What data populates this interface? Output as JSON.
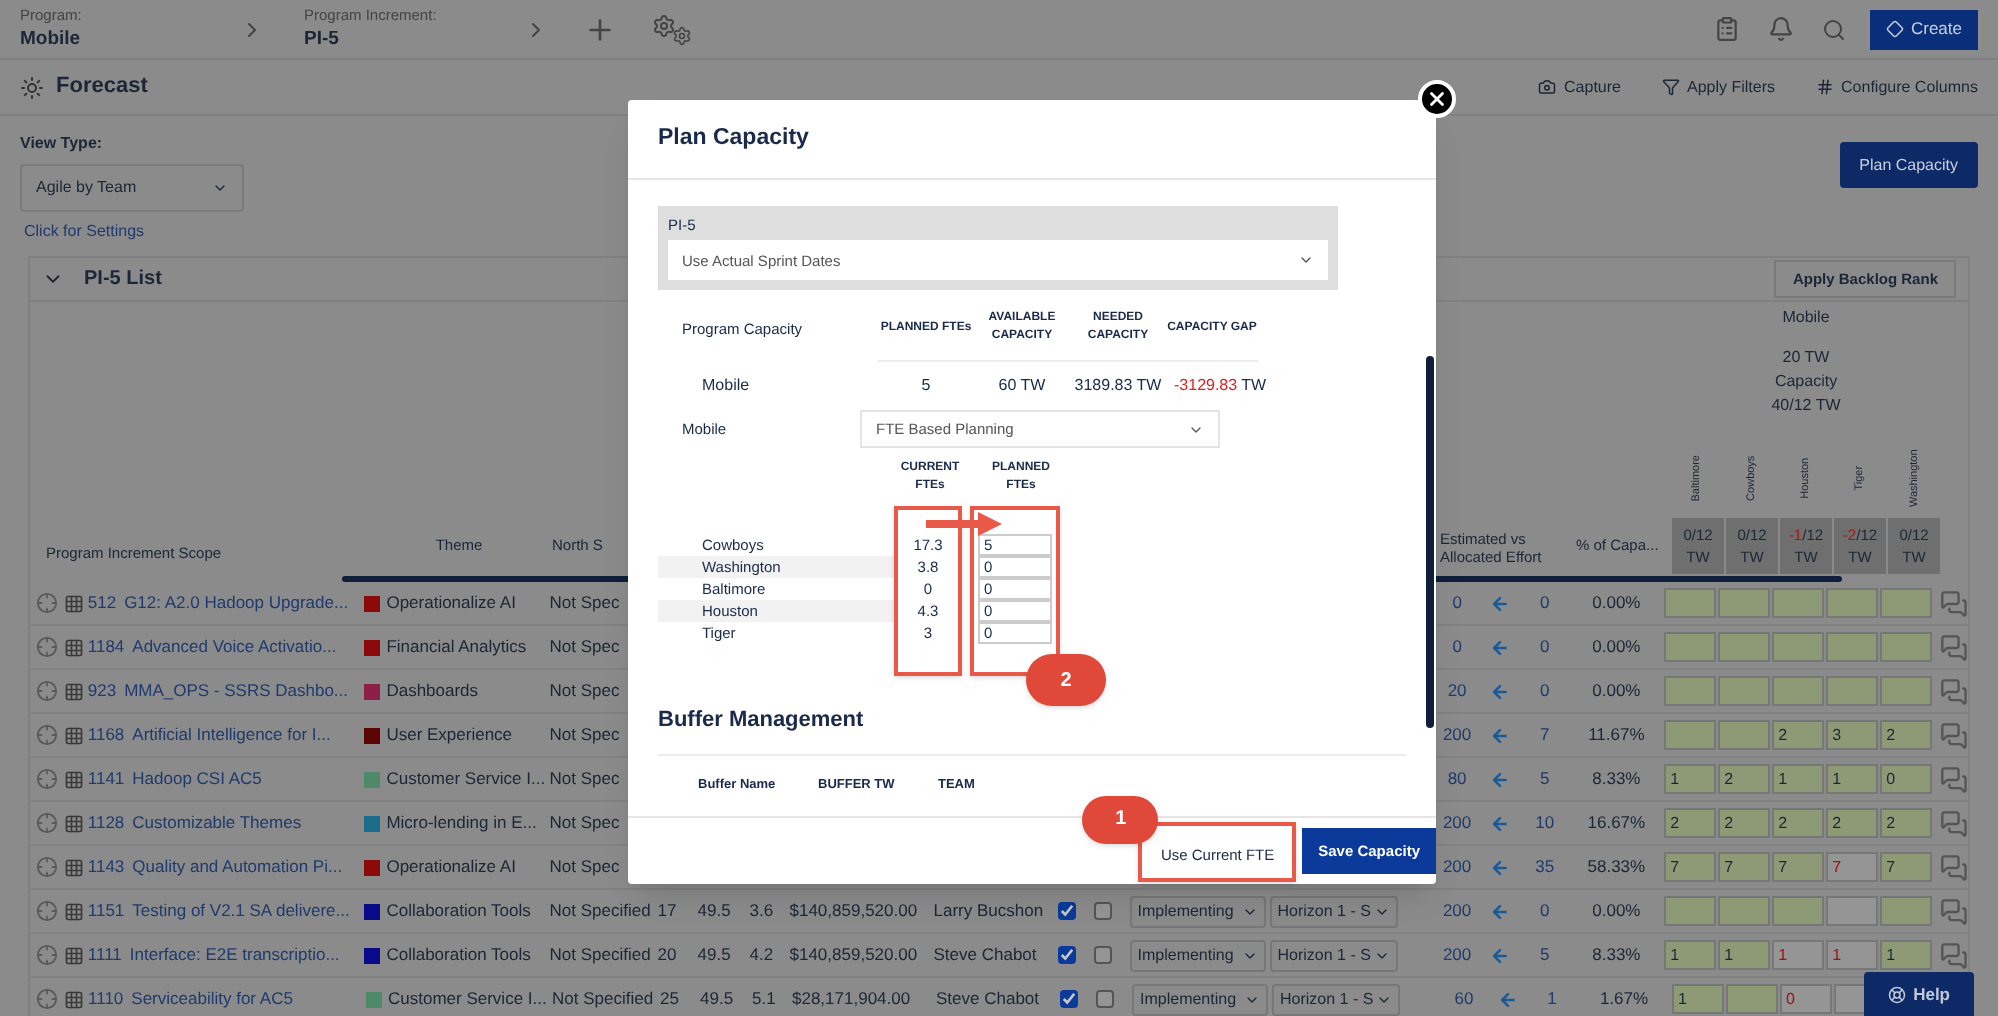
{
  "header": {
    "program_label": "Program:",
    "program": "Mobile",
    "increment_label": "Program Increment:",
    "increment": "PI-5",
    "create_button": "Create"
  },
  "toolbar": {
    "title": "Forecast",
    "actions": [
      {
        "kind": "capture",
        "label": "Capture"
      },
      {
        "kind": "filter",
        "label": "Apply Filters"
      },
      {
        "kind": "columns",
        "label": "Configure Columns"
      }
    ]
  },
  "view_type": {
    "label": "View Type:",
    "value": "Agile by Team"
  },
  "plan_capacity_button": "Plan Capacity",
  "settings_link": "Click for Settings",
  "list": {
    "title": "PI-5 List",
    "expanded": true,
    "rank_button": "Apply Backlog Rank",
    "columns": {
      "scope": "Program Increment Scope",
      "theme": "Theme",
      "north_star": "North S",
      "effort": "Estimated vs Allocated Effort",
      "capacity_pct": "% of Capa..."
    },
    "group": {
      "name": "Mobile",
      "tw": "20 TW",
      "capacity_label": "Capacity",
      "capacity": "40/12 TW"
    },
    "teams": [
      {
        "name": "Baltimore",
        "used": "0",
        "total": "/12",
        "unit": "TW",
        "over": false
      },
      {
        "name": "Cowboys",
        "used": "0",
        "total": "/12",
        "unit": "TW",
        "over": false
      },
      {
        "name": "Houston",
        "used": "-1",
        "total": "/12",
        "unit": "TW",
        "over": true
      },
      {
        "name": "Tiger",
        "used": "-2",
        "total": "/12",
        "unit": "TW",
        "over": true
      },
      {
        "name": "Washington",
        "used": "0",
        "total": "/12",
        "unit": "TW",
        "over": false
      }
    ],
    "rows": [
      {
        "id": "512",
        "title": "G12: A2.0 Hadoop Upgrade...",
        "theme": "Operationalize AI",
        "color": "#8a0a0a",
        "north_star": "Not Spec",
        "estimated": "0",
        "allocated": "0",
        "percent": "0.00%",
        "cells": [
          {
            "filled": true
          },
          {
            "filled": true
          },
          {
            "filled": true
          },
          {
            "filled": true
          },
          {
            "filled": true
          }
        ]
      },
      {
        "id": "1184",
        "title": "Advanced Voice Activatio...",
        "theme": "Financial Analytics",
        "color": "#8a0a0a",
        "north_star": "Not Spec",
        "estimated": "0",
        "allocated": "0",
        "percent": "0.00%",
        "cells": [
          {
            "filled": true
          },
          {
            "filled": true
          },
          {
            "filled": true
          },
          {
            "filled": true
          },
          {
            "filled": true
          }
        ]
      },
      {
        "id": "923",
        "title": "MMA_OPS - SSRS Dashbo...",
        "theme": "Dashboards",
        "color": "#8c1f45",
        "north_star": "Not Spec",
        "estimated": "20",
        "allocated": "0",
        "percent": "0.00%",
        "cells": [
          {
            "filled": true
          },
          {
            "filled": true
          },
          {
            "filled": true
          },
          {
            "filled": true
          },
          {
            "filled": true
          }
        ]
      },
      {
        "id": "1168",
        "title": "Artificial Intelligence for I...",
        "theme": "User Experience",
        "color": "#5c0505",
        "north_star": "Not Spec",
        "estimated": "200",
        "allocated": "7",
        "percent": "11.67%",
        "cells": [
          {
            "filled": true
          },
          {
            "filled": true
          },
          {
            "value": "2",
            "filled": true,
            "over": false
          },
          {
            "value": "3",
            "filled": true,
            "over": false
          },
          {
            "value": "2",
            "filled": true,
            "over": false
          }
        ]
      },
      {
        "id": "1141",
        "title": "Hadoop CSI AC5",
        "theme": "Customer Service I...",
        "color": "#4e8a68",
        "north_star": "Not Spec",
        "estimated": "80",
        "allocated": "5",
        "percent": "8.33%",
        "cells": [
          {
            "value": "1",
            "filled": true,
            "over": false
          },
          {
            "value": "2",
            "filled": true,
            "over": false
          },
          {
            "value": "1",
            "filled": true,
            "over": false
          },
          {
            "value": "1",
            "filled": true,
            "over": false
          },
          {
            "value": "0",
            "filled": true,
            "over": false
          }
        ]
      },
      {
        "id": "1128",
        "title": "Customizable Themes",
        "theme": "Micro-lending in E...",
        "color": "#1c6d8c",
        "north_star": "Not Spec",
        "estimated": "200",
        "allocated": "10",
        "percent": "16.67%",
        "cells": [
          {
            "value": "2",
            "filled": true,
            "over": false
          },
          {
            "value": "2",
            "filled": true,
            "over": false
          },
          {
            "value": "2",
            "filled": true,
            "over": false
          },
          {
            "value": "2",
            "filled": true,
            "over": false
          },
          {
            "value": "2",
            "filled": true,
            "over": false
          }
        ]
      },
      {
        "id": "1143",
        "title": "Quality and Automation Pi...",
        "theme": "Operationalize AI",
        "color": "#8a0a0a",
        "north_star": "Not Spec",
        "estimated": "200",
        "allocated": "35",
        "percent": "58.33%",
        "cells": [
          {
            "value": "7",
            "filled": true,
            "over": false
          },
          {
            "value": "7",
            "filled": true,
            "over": false
          },
          {
            "value": "7",
            "filled": true,
            "over": false
          },
          {
            "value": "7",
            "filled": false,
            "over": true
          },
          {
            "value": "7",
            "filled": true,
            "over": false
          }
        ]
      },
      {
        "id": "1151",
        "title": "Testing of V2.1 SA delivere...",
        "theme": "Collaboration Tools",
        "color": "#0a0a8a",
        "north_star": "Not Specified",
        "details": {
          "col_a": "17",
          "col_b": "49.5",
          "col_c": "3.6",
          "amount": "$140,859,520.00",
          "owner": "Larry Bucshon",
          "flag_a": true,
          "flag_b": false,
          "status": "Implementing",
          "horizon": "Horizon 1 - S"
        },
        "estimated": "200",
        "allocated": "0",
        "percent": "0.00%",
        "cells": [
          {
            "filled": true
          },
          {
            "filled": true
          },
          {
            "filled": true
          },
          {
            "filled": false
          },
          {
            "filled": true
          }
        ]
      },
      {
        "id": "1111",
        "title": "Interface: E2E transcriptio...",
        "theme": "Collaboration Tools",
        "color": "#0a0a8a",
        "north_star": "Not Specified",
        "details": {
          "col_a": "20",
          "col_b": "49.5",
          "col_c": "4.2",
          "amount": "$140,859,520.00",
          "owner": "Steve Chabot",
          "flag_a": true,
          "flag_b": false,
          "status": "Implementing",
          "horizon": "Horizon 1 - S"
        },
        "estimated": "200",
        "allocated": "5",
        "percent": "8.33%",
        "cells": [
          {
            "value": "1",
            "filled": true,
            "over": false
          },
          {
            "value": "1",
            "filled": true,
            "over": false
          },
          {
            "value": "1",
            "filled": false,
            "over": true
          },
          {
            "value": "1",
            "filled": false,
            "over": true
          },
          {
            "value": "1",
            "filled": true,
            "over": false
          }
        ]
      },
      {
        "id": "1110",
        "title": "Serviceability for AC5",
        "theme": "Customer Service I...",
        "color": "#4e8a68",
        "north_star": "Not Specified",
        "details": {
          "col_a": "25",
          "col_b": "49.5",
          "col_c": "5.1",
          "amount": "$28,171,904.00",
          "owner": "Steve Chabot",
          "flag_a": true,
          "flag_b": false,
          "status": "Implementing",
          "horizon": "Horizon 1 - S"
        },
        "estimated": "60",
        "allocated": "1",
        "percent": "1.67%",
        "cells": [
          {
            "value": "1",
            "filled": true,
            "over": false
          },
          {
            "filled": true
          },
          {
            "value": "0",
            "filled": false,
            "over": true
          },
          {
            "filled": false
          }
        ]
      }
    ]
  },
  "modal": {
    "title": "Plan Capacity",
    "increment_label": "PI-5",
    "date_mode": "Use Actual Sprint Dates",
    "capacity_label": "Program Capacity",
    "capacity_headers": [
      "PLANNED FTEs",
      "AVAILABLE CAPACITY",
      "NEEDED CAPACITY",
      "CAPACITY GAP"
    ],
    "capacity_row": {
      "name": "Mobile",
      "planned": "5",
      "available": "60 TW",
      "needed": "3189.83 TW",
      "gap": "-3129.83",
      "gap_unit": "TW",
      "gap_negative": true
    },
    "team_label": "Mobile",
    "planning_mode": "FTE Based Planning",
    "fte_headers": [
      "CURRENT FTEs",
      "PLANNED FTEs"
    ],
    "fte_teams": [
      {
        "name": "Cowboys",
        "current": "17.3",
        "planned": "5"
      },
      {
        "name": "Washington",
        "current": "3.8",
        "planned": "0"
      },
      {
        "name": "Baltimore",
        "current": "0",
        "planned": "0"
      },
      {
        "name": "Houston",
        "current": "4.3",
        "planned": "0"
      },
      {
        "name": "Tiger",
        "current": "3",
        "planned": "0"
      }
    ],
    "buffer_title": "Buffer Management",
    "buffer_headers": [
      "Buffer Name",
      "BUFFER TW",
      "TEAM"
    ],
    "use_current_button": "Use Current FTE",
    "save_button": "Save Capacity",
    "callouts": {
      "planned_fte": "2",
      "use_current": "1"
    }
  },
  "help_button": "Help"
}
